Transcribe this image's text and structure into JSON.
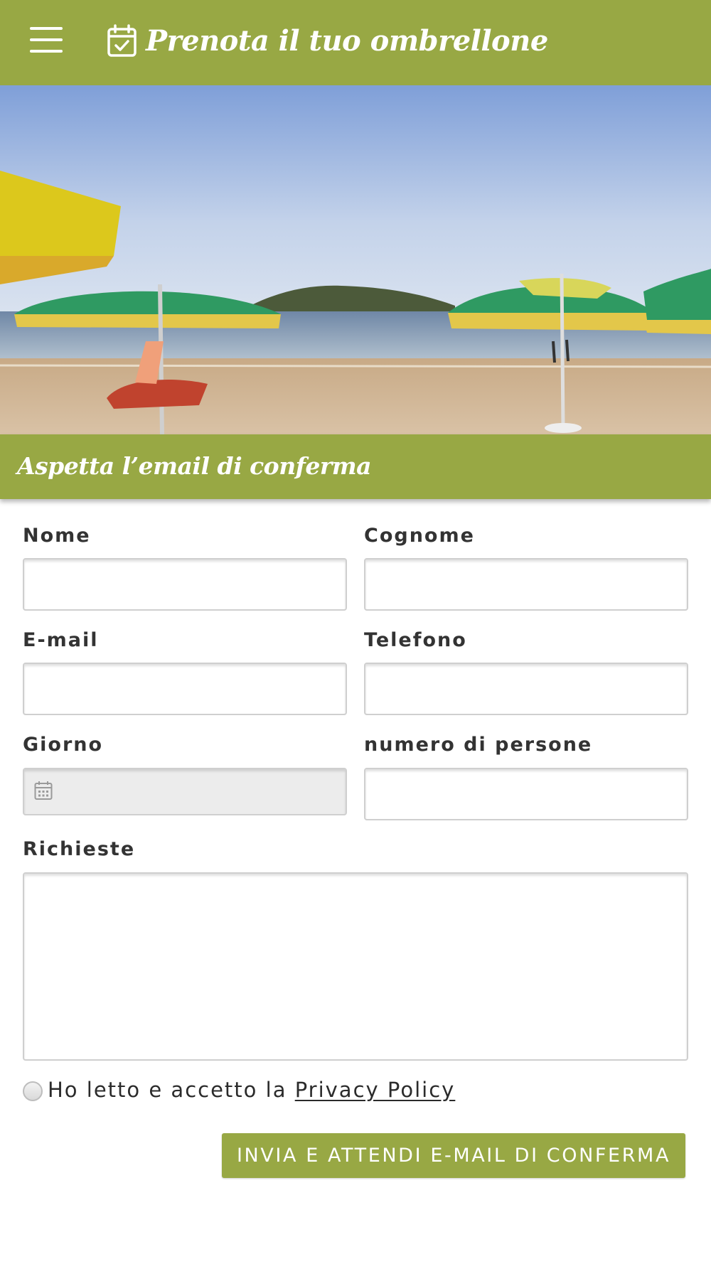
{
  "header": {
    "title": "Prenota il tuo ombrellone",
    "menu_icon": "hamburger-menu-icon",
    "title_icon": "calendar-check-icon"
  },
  "banner": {
    "text": "Aspetta l’email di conferma"
  },
  "form": {
    "nome_label": "Nome",
    "cognome_label": "Cognome",
    "email_label": "E-mail",
    "telefono_label": "Telefono",
    "giorno_label": "Giorno",
    "persone_label": "numero di persone",
    "richieste_label": "Richieste",
    "privacy_prefix": "Ho letto e accetto la",
    "privacy_link": "Privacy Policy",
    "submit_label": "INVIA E ATTENDI E-MAIL DI CONFERMA"
  },
  "colors": {
    "brand": "#98a844",
    "text": "#2b2b2b",
    "white": "#ffffff"
  }
}
